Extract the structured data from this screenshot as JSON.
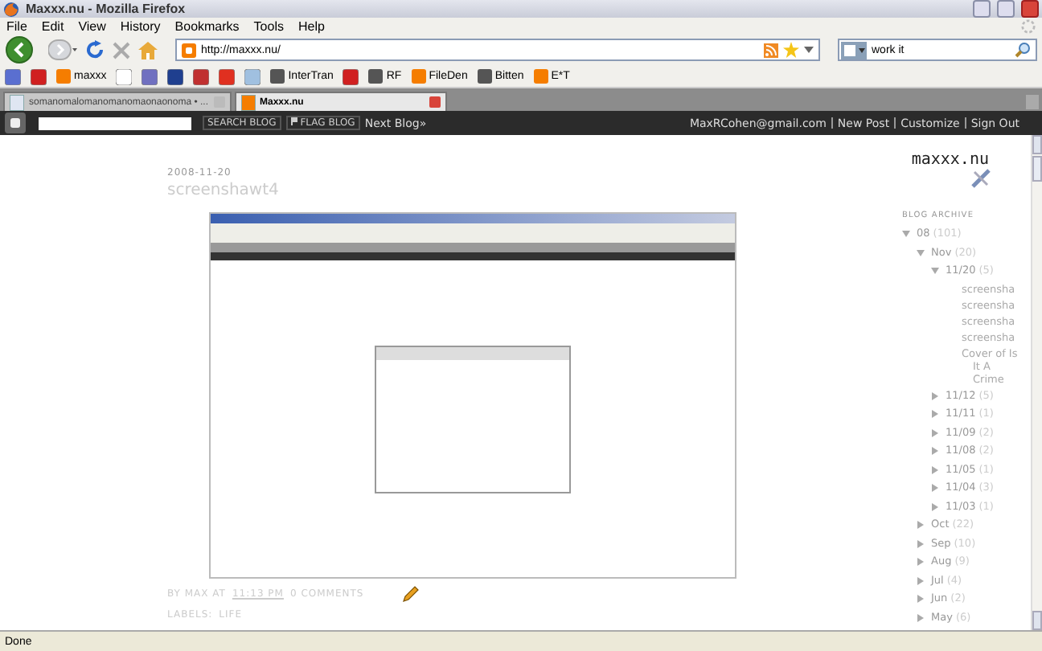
{
  "window": {
    "title": "Maxxx.nu - Mozilla Firefox"
  },
  "menu": [
    "File",
    "Edit",
    "View",
    "History",
    "Bookmarks",
    "Tools",
    "Help"
  ],
  "address": {
    "value": "http://maxxx.nu/"
  },
  "search": {
    "value": "work it"
  },
  "bookmarks": [
    {
      "kind": "icon"
    },
    {
      "kind": "icon"
    },
    {
      "kind": "labeled",
      "label": "maxxx"
    },
    {
      "kind": "icon"
    },
    {
      "kind": "icon"
    },
    {
      "kind": "icon"
    },
    {
      "kind": "icon"
    },
    {
      "kind": "icon"
    },
    {
      "kind": "icon"
    },
    {
      "kind": "labeled",
      "label": "InterTran"
    },
    {
      "kind": "icon"
    },
    {
      "kind": "labeled",
      "label": "RF"
    },
    {
      "kind": "labeled",
      "label": "FileDen"
    },
    {
      "kind": "labeled",
      "label": "Bitten"
    },
    {
      "kind": "labeled",
      "label": "E*T"
    }
  ],
  "tabs": [
    {
      "label": "somanomalomanomanomaonaonoma • ...",
      "selected": false
    },
    {
      "label": "Maxxx.nu",
      "selected": true
    }
  ],
  "navbar": {
    "search_button": "SEARCH BLOG",
    "flag_button": "FLAG BLOG",
    "next_blog": "Next Blog»",
    "email": "MaxRCohen@gmail.com",
    "links": [
      "New Post",
      "Customize",
      "Sign Out"
    ]
  },
  "post": {
    "date": "2008-11-20",
    "title": "screenshawt4",
    "byline": "BY MAX AT",
    "time": "11:13 PM",
    "comments": "0 COMMENTS",
    "labels_heading": "LABELS:",
    "label": "LIFE"
  },
  "sidebar": {
    "blog_title": "maxxx.nu",
    "archive_heading": "BLOG ARCHIVE",
    "archive": [
      {
        "label": "08",
        "count": "(101)",
        "expanded": true,
        "children": [
          {
            "label": "Nov",
            "count": "(20)",
            "expanded": true,
            "children": [
              {
                "label": "11/20",
                "count": "(5)",
                "expanded": true,
                "children": [
                  {
                    "label": "screensha"
                  },
                  {
                    "label": "screensha"
                  },
                  {
                    "label": "screensha"
                  },
                  {
                    "label": "screensha"
                  },
                  {
                    "label": "Cover of Is It A Crime"
                  }
                ]
              },
              {
                "label": "11/12",
                "count": "(5)",
                "expanded": false
              },
              {
                "label": "11/11",
                "count": "(1)",
                "expanded": false
              },
              {
                "label": "11/09",
                "count": "(2)",
                "expanded": false
              },
              {
                "label": "11/08",
                "count": "(2)",
                "expanded": false
              },
              {
                "label": "11/05",
                "count": "(1)",
                "expanded": false
              },
              {
                "label": "11/04",
                "count": "(3)",
                "expanded": false
              },
              {
                "label": "11/03",
                "count": "(1)",
                "expanded": false
              }
            ]
          },
          {
            "label": "Oct",
            "count": "(22)",
            "expanded": false
          },
          {
            "label": "Sep",
            "count": "(10)",
            "expanded": false
          },
          {
            "label": "Aug",
            "count": "(9)",
            "expanded": false
          },
          {
            "label": "Jul",
            "count": "(4)",
            "expanded": false
          },
          {
            "label": "Jun",
            "count": "(2)",
            "expanded": false
          },
          {
            "label": "May",
            "count": "(6)",
            "expanded": false
          }
        ]
      }
    ]
  },
  "status_bar": "Done"
}
